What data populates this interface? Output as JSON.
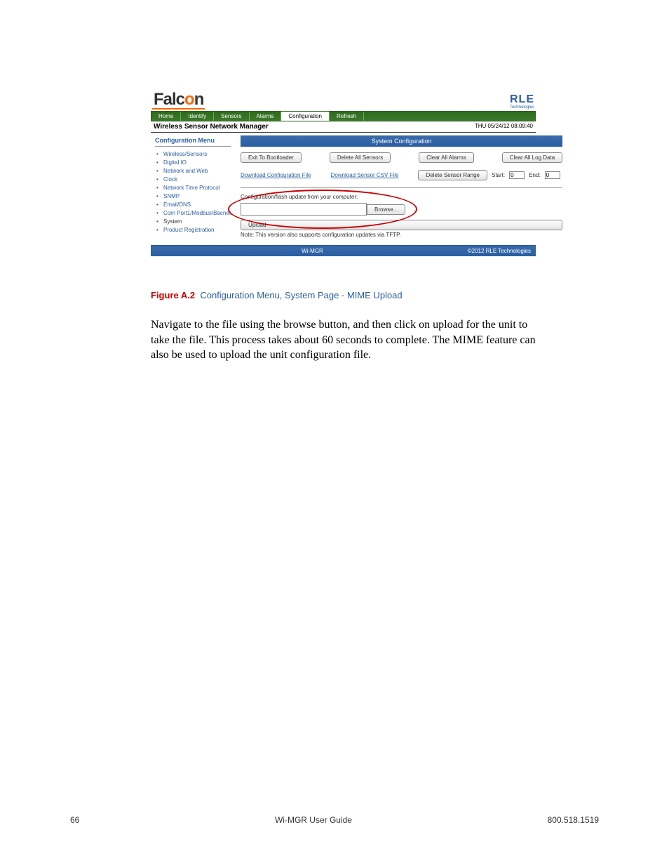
{
  "logos": {
    "falcon_pre": "Falc",
    "falcon_o": "o",
    "falcon_post": "n",
    "rle_big": "RLE",
    "rle_small": "Technologies"
  },
  "tabs": {
    "home": "Home",
    "identify": "Identify",
    "sensors": "Sensors",
    "alarms": "Alarms",
    "configuration": "Configuration",
    "refresh": "Refresh"
  },
  "subheader": {
    "title": "Wireless Sensor Network Manager",
    "timestamp": "THU 05/24/12 08:09:40"
  },
  "menu": {
    "title": "Configuration Menu",
    "items": {
      "wireless_sensors": "Wireless/Sensors",
      "digital_io": "Digital IO",
      "network_web": "Network and Web",
      "clock": "Clock",
      "ntp": "Network Time Protocol",
      "snmp": "SNMP",
      "email_dns": "Email/DNS",
      "com": "Com Port1/Modbus/Bacnet",
      "system": "System",
      "product_reg": "Product Registration"
    }
  },
  "main": {
    "section_header": "System Configuration",
    "row1": {
      "exit_bootloader": "Exit To Bootloader",
      "delete_sensors": "Delete All Sensors",
      "clear_alarms": "Clear All Alarms",
      "clear_log": "Clear All Log Data"
    },
    "row2": {
      "download_config": "Download Configuration File",
      "download_csv": "Download Sensor CSV File",
      "delete_range": "Delete Sensor Range",
      "start_label": "Start:",
      "start_value": "0",
      "end_label": "End:",
      "end_value": "0"
    },
    "upload": {
      "label": "Configuration/flash update from your computer:",
      "browse": "Browse...",
      "upload": "Upload",
      "note": "Note: This version also supports configuration updates via TFTP."
    }
  },
  "shot_footer": {
    "center": "Wi-MGR",
    "right": "©2012 RLE Technologies"
  },
  "caption": {
    "label": "Figure A.2",
    "text": "Configuration Menu, System Page - MIME Upload"
  },
  "paragraph": "Navigate to the file using the browse button, and then click on upload for the unit to take the file. This process takes about 60 seconds to complete. The MIME feature can also be used to upload the unit configuration file.",
  "footer": {
    "left": "66",
    "center": "Wi-MGR User Guide",
    "right": "800.518.1519"
  }
}
